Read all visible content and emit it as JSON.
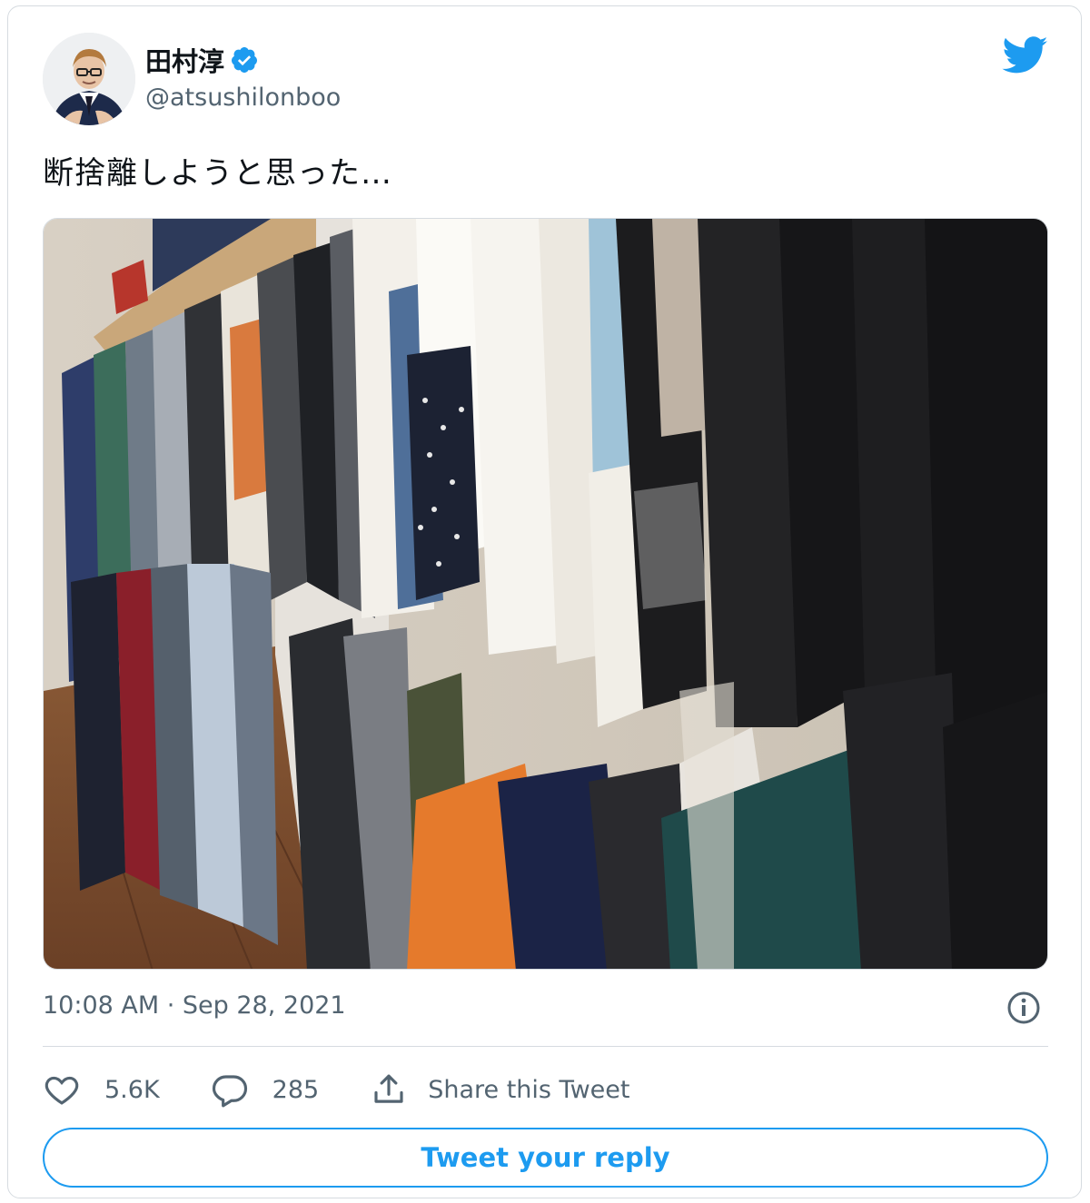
{
  "author": {
    "display_name": "田村淳",
    "handle": "@atsushilonboo",
    "verified": true
  },
  "tweet": {
    "text": "断捨離しようと思った…",
    "timestamp": "10:08 AM · Sep 28, 2021"
  },
  "actions": {
    "like_count": "5.6K",
    "reply_count": "285",
    "share_label": "Share this Tweet"
  },
  "reply_button": {
    "label": "Tweet your reply"
  },
  "icons": {
    "brand": "twitter-bird-icon",
    "verified": "verified-badge-icon",
    "info": "info-icon",
    "like": "heart-icon",
    "reply": "reply-bubble-icon",
    "share": "share-icon"
  },
  "colors": {
    "accent": "#1d9bf0",
    "text_primary": "#0f1419",
    "text_secondary": "#536471",
    "border": "#d6dbe0"
  }
}
